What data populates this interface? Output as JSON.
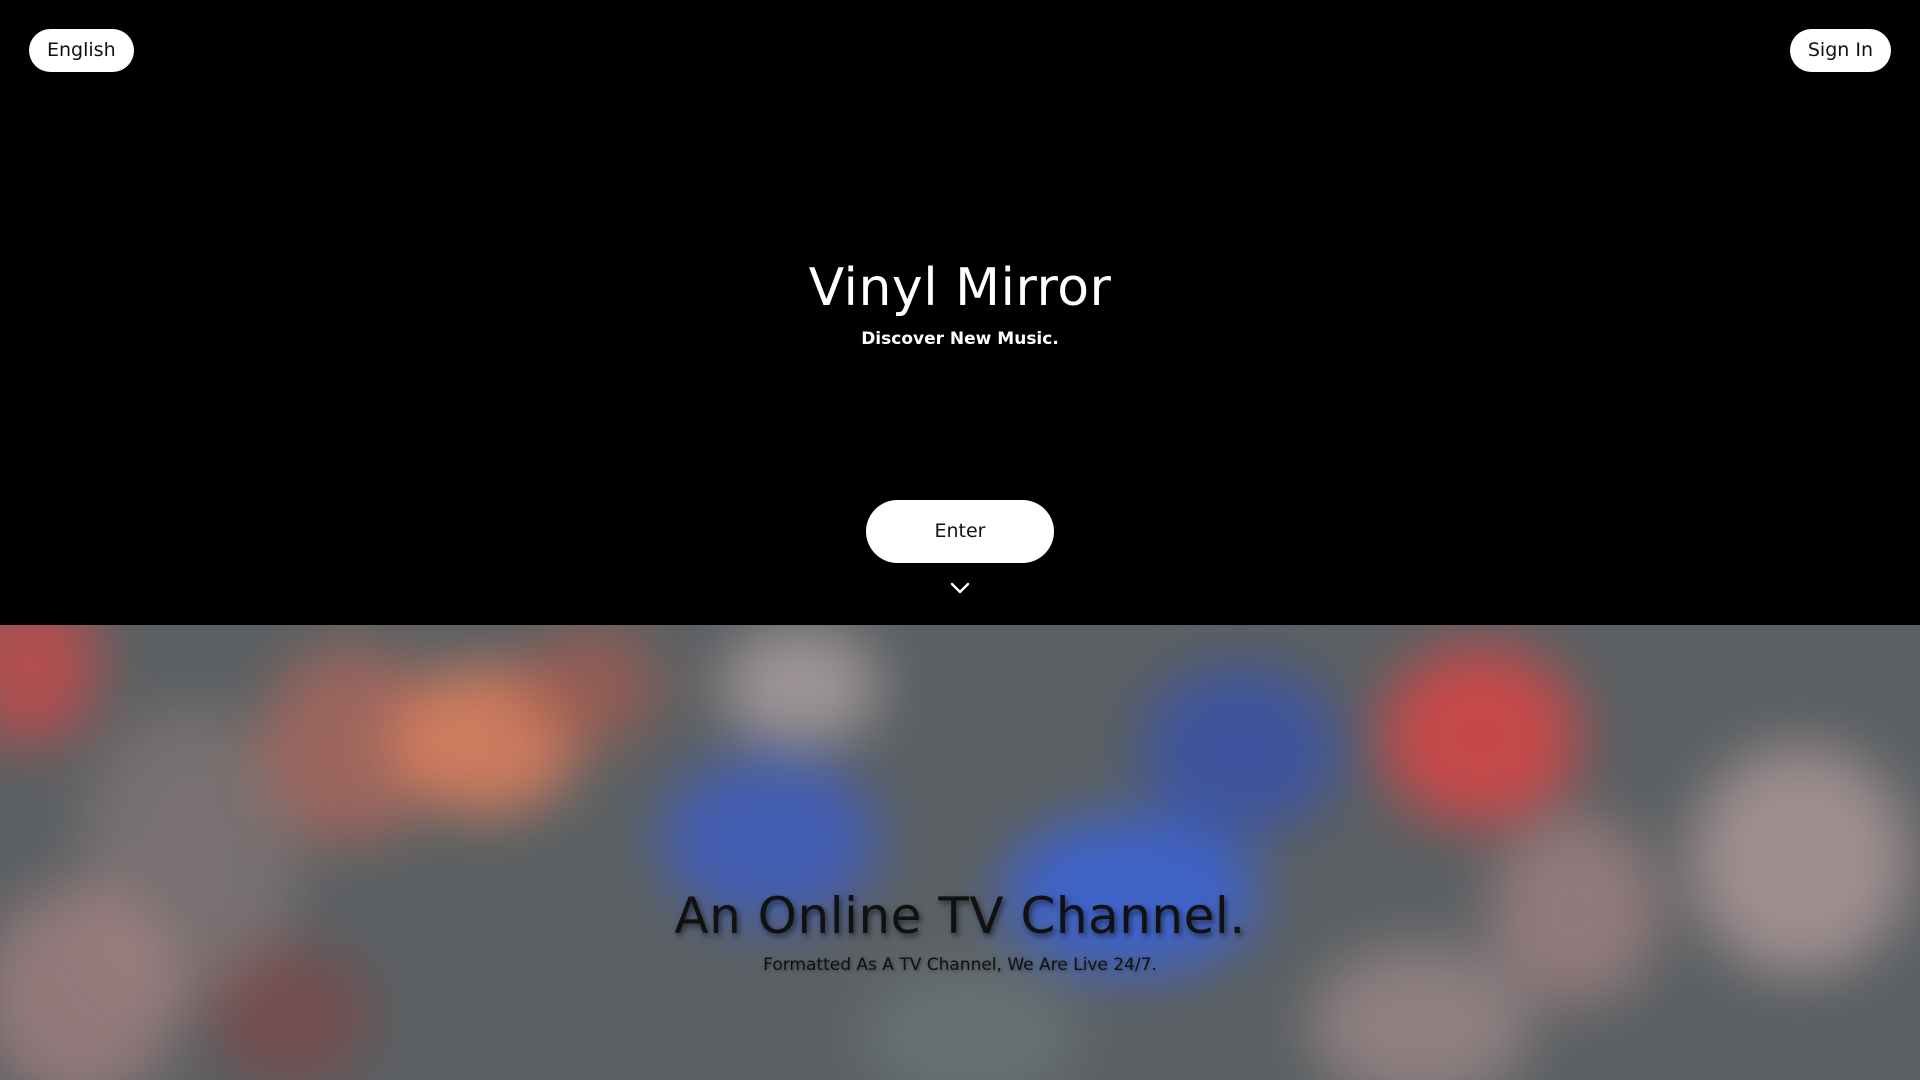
{
  "header": {
    "language_label": "English",
    "sign_in_label": "Sign In"
  },
  "hero": {
    "title": "Vinyl Mirror",
    "tagline": "Discover New Music.",
    "enter_label": "Enter",
    "scroll_icon": "chevron-down-icon"
  },
  "feature": {
    "title": "An Online TV Channel.",
    "subtitle": "Formatted As A TV Channel, We Are Live 24/7."
  },
  "colors": {
    "hero_background": "#000000",
    "button_background": "#ffffff",
    "button_text": "#111111"
  }
}
